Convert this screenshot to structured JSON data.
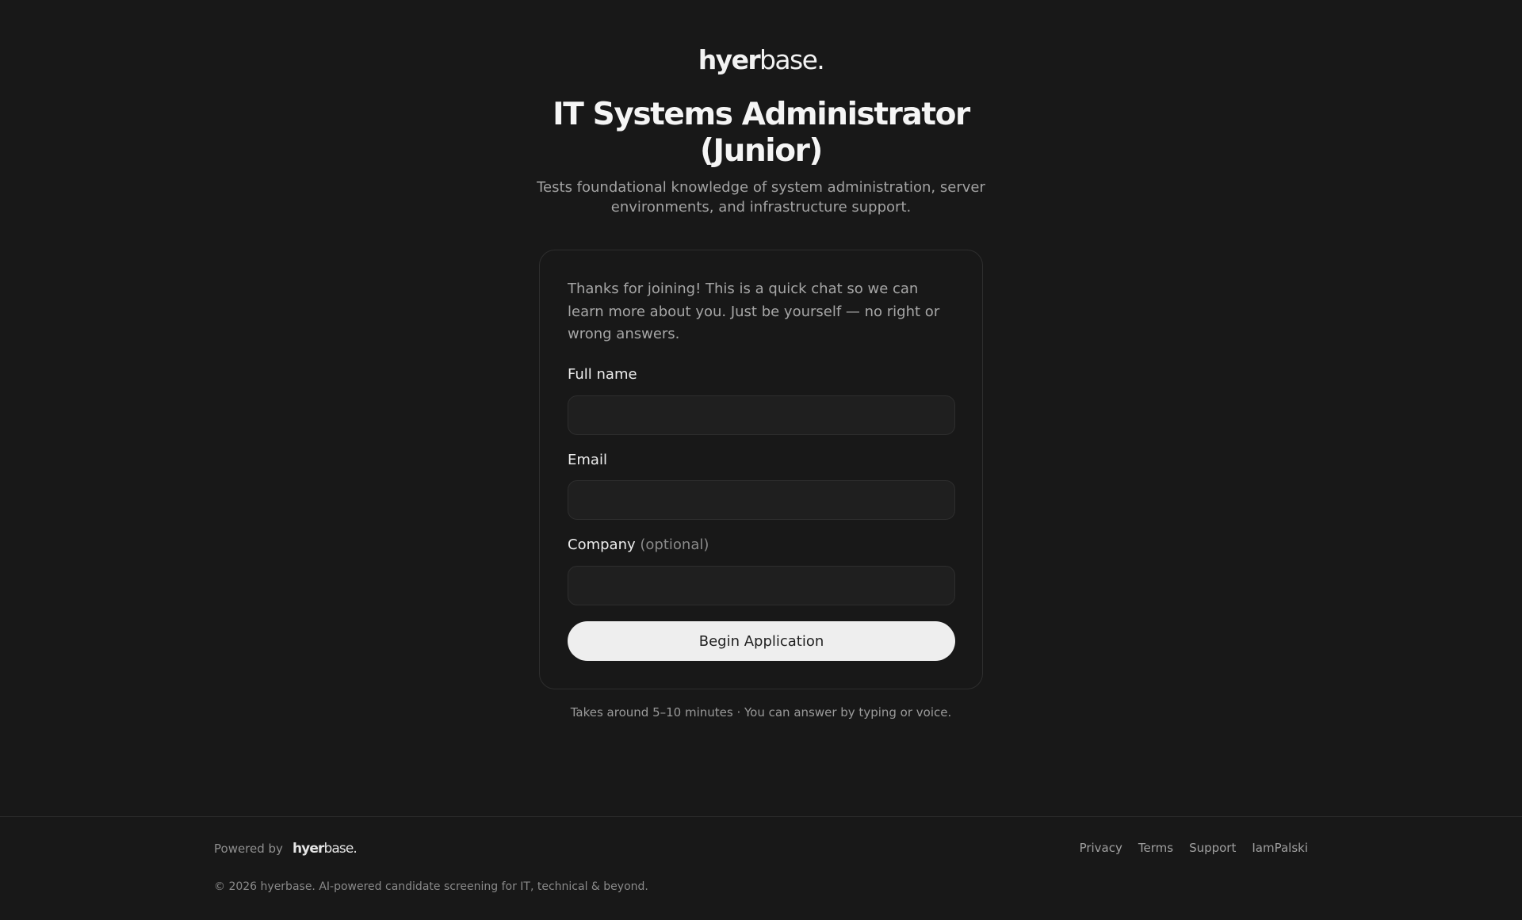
{
  "brand": {
    "name_bold": "hyer",
    "name_light": "base."
  },
  "header": {
    "title": "IT Systems Administrator (Junior)",
    "subtitle": "Tests foundational knowledge of system administration, server environments, and infrastructure support."
  },
  "form": {
    "intro": "Thanks for joining! This is a quick chat so we can learn more about you. Just be yourself — no right or wrong answers.",
    "fields": {
      "full_name": {
        "label": "Full name",
        "value": ""
      },
      "email": {
        "label": "Email",
        "value": ""
      },
      "company": {
        "label": "Company",
        "optional": "(optional)",
        "value": ""
      }
    },
    "submit_label": "Begin Application"
  },
  "note": "Takes around 5–10 minutes · You can answer by typing or voice.",
  "footer": {
    "powered_by": "Powered by",
    "links": [
      "Privacy",
      "Terms",
      "Support",
      "IamPalski"
    ],
    "copyright": "© 2026 hyerbase. AI-powered candidate screening for IT, technical & beyond."
  }
}
